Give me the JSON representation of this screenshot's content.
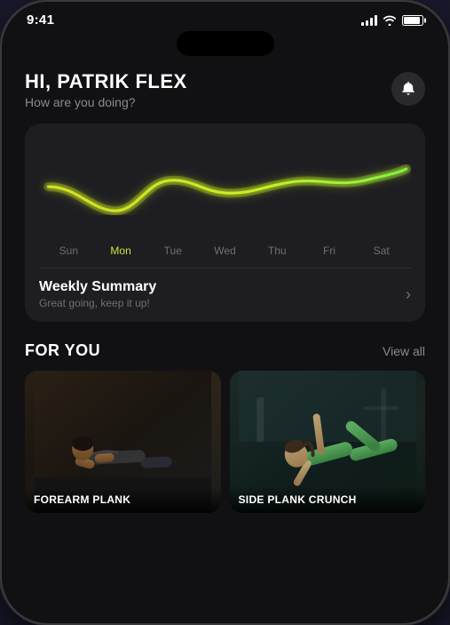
{
  "statusBar": {
    "time": "9:41",
    "batteryLevel": "90%"
  },
  "header": {
    "greeting": "HI, PATRIK FLEX",
    "subtitle": "How are you doing?",
    "bellLabel": "notifications"
  },
  "chart": {
    "days": [
      {
        "label": "Sun",
        "active": false
      },
      {
        "label": "Mon",
        "active": true
      },
      {
        "label": "Tue",
        "active": false
      },
      {
        "label": "Wed",
        "active": false
      },
      {
        "label": "Thu",
        "active": false
      },
      {
        "label": "Fri",
        "active": false
      },
      {
        "label": "Sat",
        "active": false
      }
    ],
    "weeklySummary": {
      "title": "Weekly Summary",
      "subtitle": "Great going, keep it up!"
    }
  },
  "forYou": {
    "sectionTitle": "FOR YOU",
    "viewAll": "View all",
    "cards": [
      {
        "title": "FOREARM PLANK",
        "type": "forearm-plank"
      },
      {
        "title": "SIDE PLANK CRUNCH",
        "type": "side-plank-crunch"
      }
    ]
  },
  "icons": {
    "bell": "🔔",
    "chevronRight": "›"
  }
}
